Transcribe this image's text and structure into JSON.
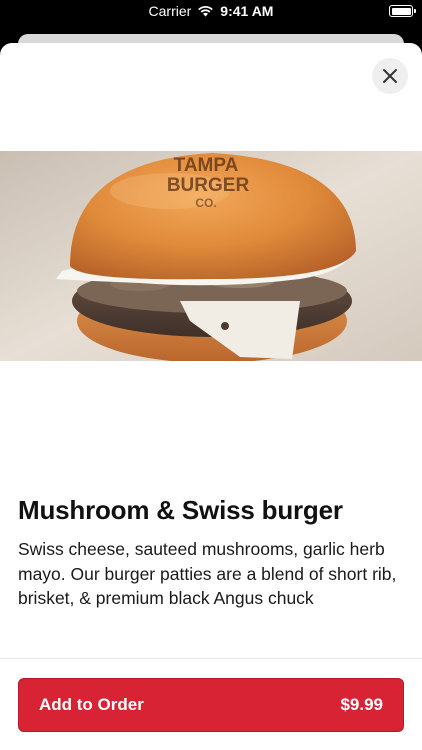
{
  "status_bar": {
    "carrier": "Carrier",
    "time": "9:41 AM"
  },
  "sheet": {
    "close_icon": "close-icon"
  },
  "item": {
    "image_description_icon": "burger-photo",
    "bun_text_line1": "TAMPA",
    "bun_text_line2": "BURGER",
    "bun_text_line3": "CO.",
    "title": "Mushroom & Swiss burger",
    "description": "Swiss cheese, sauteed mushrooms, garlic herb mayo. Our burger patties are a blend of short rib, brisket, & premium black Angus chuck"
  },
  "order_button": {
    "label": "Add to Order",
    "price": "$9.99"
  },
  "colors": {
    "accent": "#d72334",
    "sheet_background": "#ffffff",
    "status_bar_background": "#000000"
  }
}
